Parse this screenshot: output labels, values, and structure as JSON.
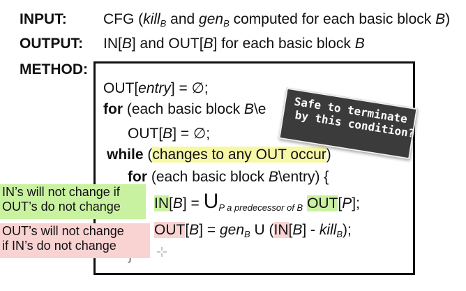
{
  "header": {
    "input_label": "INPUT",
    "input_colon": ":",
    "input_text_1": "CFG (",
    "input_kill": "kill",
    "input_kill_sub": "B",
    "input_and": " and ",
    "input_gen": "gen",
    "input_gen_sub": "B",
    "input_text_2": " computed for each basic block ",
    "input_B": "B",
    "input_close": ")",
    "output_label": "OUTPUT",
    "output_colon": ":",
    "output_text_1": "IN[",
    "output_B1": "B",
    "output_text_2": "] and OUT[",
    "output_B2": "B",
    "output_text_3": "] for each basic block ",
    "output_B3": "B",
    "method_label": "METHOD",
    "method_colon": ":"
  },
  "code": {
    "line1_a": "OUT[",
    "line1_entry": "entry",
    "line1_b": "] = ∅;",
    "line2_for": "for",
    "line2_rest": " (each basic block ",
    "line2_B": "B",
    "line2_tail": "\\e",
    "line3_a": "OUT[",
    "line3_B": "B",
    "line3_b": "] = ∅;",
    "line4_while": "while",
    "line4_open": " (",
    "line4_cond": "changes to any OUT occur",
    "line4_close": ")",
    "line5_for": "for",
    "line5_rest": " (each basic block ",
    "line5_B": "B",
    "line5_entry": "\\entry",
    "line5_close": ") {",
    "line6_in": "IN",
    "line6_a": "[",
    "line6_B": "B",
    "line6_b": "] = ",
    "line6_union": "U",
    "line6_sub": "P a predecessor of B",
    "line6_out": "OUT",
    "line6_c": "[",
    "line6_P": "P",
    "line6_d": "];",
    "line7_out": "OUT",
    "line7_a": "[",
    "line7_B": "B",
    "line7_b": "] = ",
    "line7_gen": "gen",
    "line7_gen_sub": "B",
    "line7_union": " U (",
    "line7_in": "IN",
    "line7_c": "[",
    "line7_B2": "B",
    "line7_d": "] - ",
    "line7_kill": "kill",
    "line7_kill_sub": "B",
    "line7_e": ");",
    "line8_brace": "}"
  },
  "callout": {
    "line1": "Safe to terminate",
    "line2": "by this condition?"
  },
  "notes": {
    "green_line1": "IN’s will not change if",
    "green_line2": "OUT’s do not change",
    "pink_line1": "OUT’s will not change",
    "pink_line2": "if IN’s do not change"
  },
  "colors": {
    "highlight_yellow": "#f7f7a8",
    "highlight_green": "#c9f2a0",
    "highlight_pink": "#f9d2d2",
    "callout_bg": "#3b3b3b"
  },
  "icons": {
    "cursor": "crosshair-cursor-icon"
  }
}
